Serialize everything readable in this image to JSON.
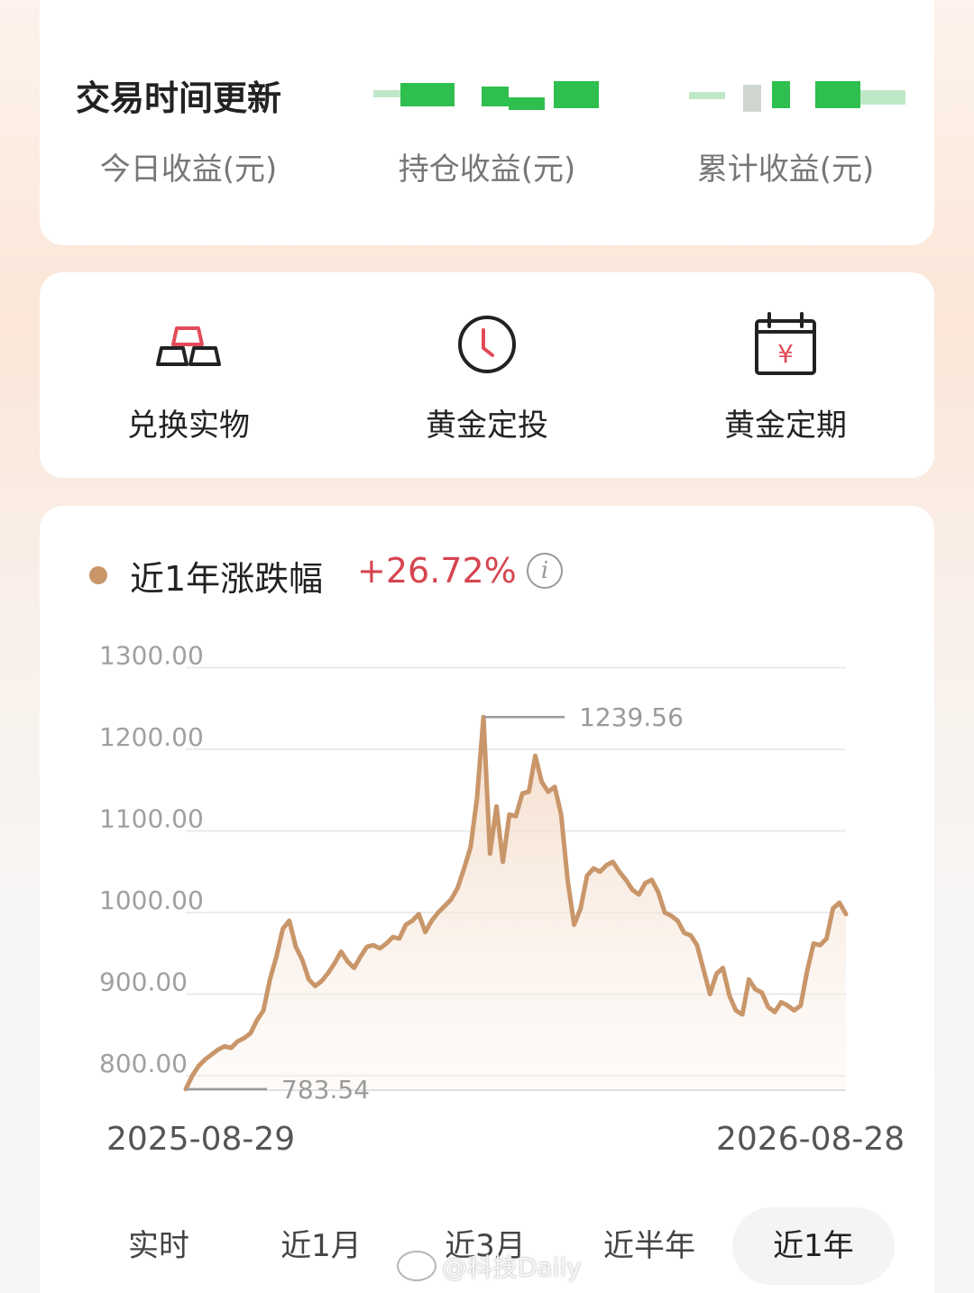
{
  "summary": {
    "title": "交易时间更新",
    "metrics": [
      {
        "label": "今日收益(元)"
      },
      {
        "label": "持仓收益(元)"
      },
      {
        "label": "累计收益(元)"
      }
    ]
  },
  "actions": [
    {
      "label": "兑换实物",
      "icon": "gold-bars-icon"
    },
    {
      "label": "黄金定投",
      "icon": "clock-icon"
    },
    {
      "label": "黄金定期",
      "icon": "calendar-yen-icon"
    }
  ],
  "chart_header": {
    "label": "近1年涨跌幅",
    "change": "+26.72%"
  },
  "colors": {
    "line": "#c9966a",
    "positive": "#d6454f"
  },
  "chart_data": {
    "type": "area",
    "ylim": [
      770,
      1300
    ],
    "yticks": [
      "1300.00",
      "1200.00",
      "1100.00",
      "1000.00",
      "900.00",
      "800.00"
    ],
    "ytick_values": [
      1300,
      1200,
      1100,
      1000,
      900,
      800
    ],
    "start_date": "2025-08-29",
    "end_date": "2026-08-28",
    "max_label": "1239.56",
    "min_label": "783.54",
    "max_value": 1239.56,
    "min_value": 783.54,
    "values": [
      783.54,
      800,
      812,
      820,
      826,
      832,
      836,
      834,
      842,
      846,
      852,
      868,
      880,
      918,
      946,
      980,
      990,
      958,
      942,
      918,
      910,
      916,
      926,
      938,
      952,
      940,
      932,
      946,
      958,
      960,
      956,
      962,
      970,
      968,
      985,
      990,
      998,
      976,
      990,
      1000,
      1008,
      1016,
      1030,
      1054,
      1080,
      1140,
      1239.56,
      1072,
      1130,
      1062,
      1120,
      1118,
      1146,
      1148,
      1192,
      1160,
      1148,
      1154,
      1120,
      1040,
      985,
      1005,
      1045,
      1054,
      1050,
      1058,
      1062,
      1050,
      1040,
      1028,
      1022,
      1036,
      1040,
      1025,
      1000,
      996,
      990,
      975,
      972,
      960,
      930,
      900,
      925,
      932,
      898,
      880,
      875,
      918,
      906,
      902,
      884,
      878,
      890,
      886,
      880,
      886,
      928,
      962,
      960,
      968,
      1005,
      1012,
      998
    ]
  },
  "ranges": [
    {
      "label": "实时"
    },
    {
      "label": "近1月"
    },
    {
      "label": "近3月"
    },
    {
      "label": "近半年"
    },
    {
      "label": "近1年",
      "active": true
    }
  ],
  "watermark": "@科技Daily"
}
